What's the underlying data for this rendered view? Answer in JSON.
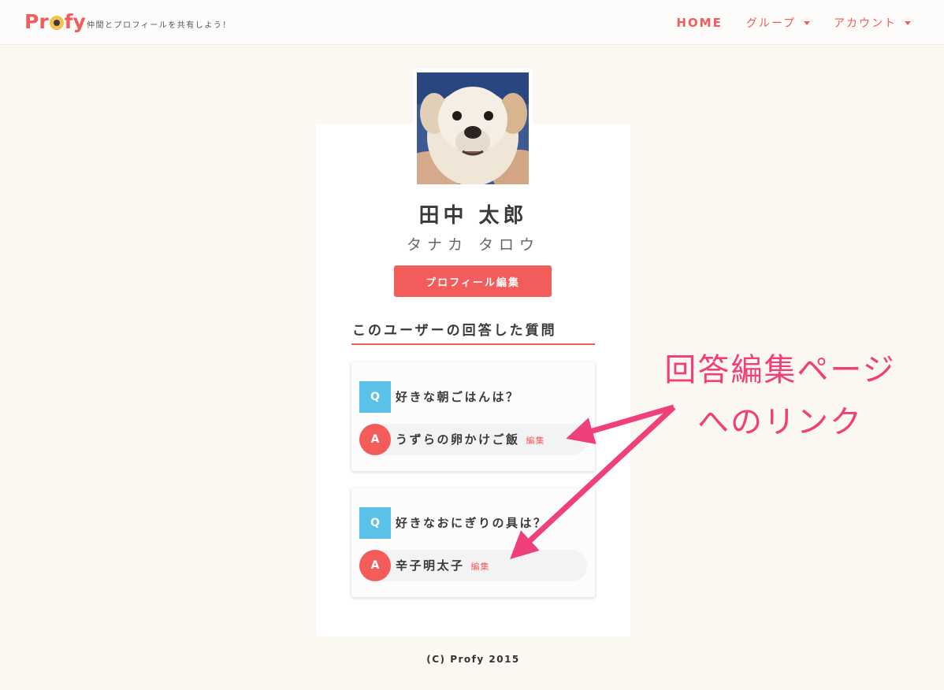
{
  "header": {
    "logo": {
      "prefix": "Pr",
      "suffix": "fy"
    },
    "tagline": "仲間とプロフィールを共有しよう！",
    "nav": {
      "home": "HOME",
      "group": "グループ",
      "account": "アカウント"
    }
  },
  "profile": {
    "name": "田中 太郎",
    "kana": "タナカ タロウ",
    "edit_button": "プロフィール編集"
  },
  "section_title": "このユーザーの回答した質問",
  "qa": [
    {
      "q_badge": "Q",
      "question": "好きな朝ごはんは？",
      "a_badge": "A",
      "answer": "うずらの卵かけご飯",
      "edit": "編集"
    },
    {
      "q_badge": "Q",
      "question": "好きなおにぎりの具は？",
      "a_badge": "A",
      "answer": "辛子明太子",
      "edit": "編集"
    }
  ],
  "annotation": {
    "line1": "回答編集ページ",
    "line2": "へのリンク"
  },
  "footer": "(C) Profy 2015",
  "colors": {
    "accent": "#f25c5a",
    "question": "#5bc0ea",
    "annotation": "#f0407a"
  }
}
